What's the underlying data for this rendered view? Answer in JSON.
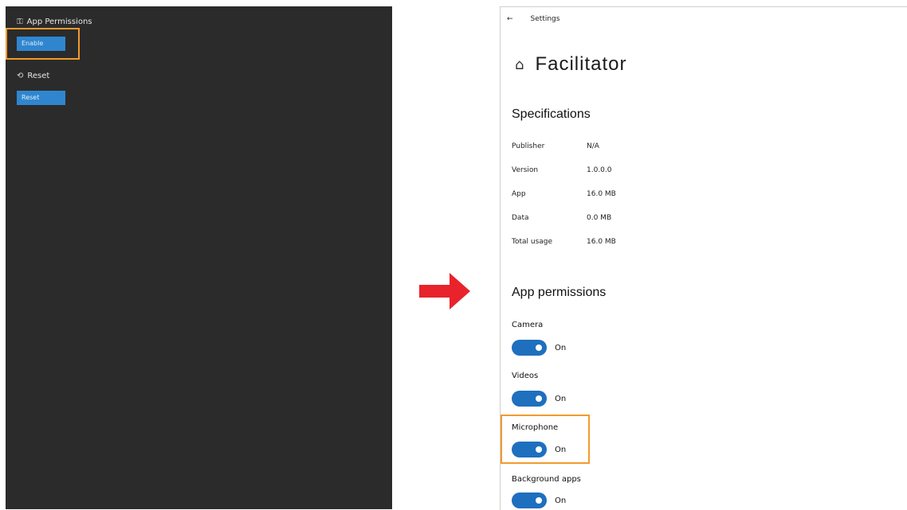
{
  "left_panel": {
    "app_permissions": {
      "icon": "permissions-icon",
      "label": "App Permissions",
      "button_label": "Enable"
    },
    "reset": {
      "icon": "reset-icon",
      "label": "Reset",
      "button_label": "Reset"
    }
  },
  "settings": {
    "back_icon": "back-arrow-icon",
    "window_title": "Settings",
    "home_icon": "home-icon",
    "page_title": "Facilitator",
    "specifications": {
      "heading": "Specifications",
      "rows": [
        {
          "key": "Publisher",
          "value": "N/A"
        },
        {
          "key": "Version",
          "value": "1.0.0.0"
        },
        {
          "key": "App",
          "value": "16.0 MB"
        },
        {
          "key": "Data",
          "value": "0.0 MB"
        },
        {
          "key": "Total usage",
          "value": "16.0 MB"
        }
      ]
    },
    "app_permissions": {
      "heading": "App permissions",
      "items": [
        {
          "label": "Camera",
          "state": "On"
        },
        {
          "label": "Videos",
          "state": "On"
        },
        {
          "label": "Microphone",
          "state": "On"
        },
        {
          "label": "Background apps",
          "state": "On"
        }
      ]
    }
  },
  "colors": {
    "accent": "#2f86cf",
    "toggle_on": "#1f6fbf",
    "highlight": "#f29b2d",
    "arrow": "#e8232b",
    "dark_panel": "#2b2b2b"
  }
}
